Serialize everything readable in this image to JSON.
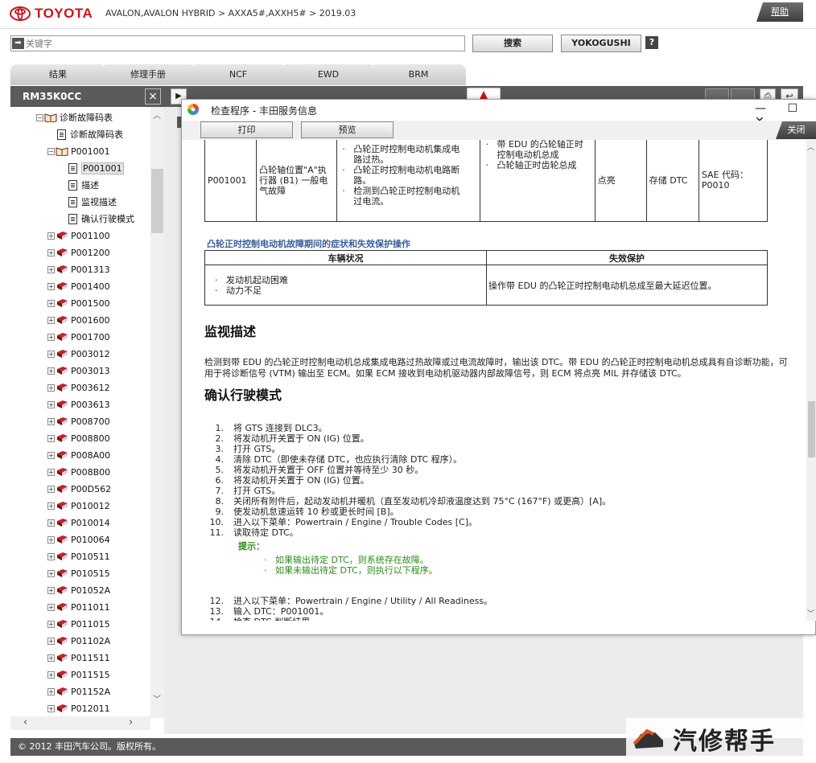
{
  "header": {
    "brand": "TOYOTA",
    "breadcrumb": "AVALON,AVALON HYBRID > AXXA5#,AXXH5# > 2019.03",
    "help_label": "帮助"
  },
  "search": {
    "placeholder": "关键字",
    "search_button": "搜索",
    "yokogushi_button": "YOKOGUSHI",
    "help_icon": "?"
  },
  "tabs": [
    "结果",
    "修理手册",
    "NCF",
    "EWD",
    "BRM"
  ],
  "left_panel": {
    "title": "RM35K0CC",
    "close": "×",
    "tree": [
      {
        "label": "诊断故障码表",
        "kind": "book-open",
        "indent": 1,
        "expander": "−"
      },
      {
        "label": "诊断故障码表",
        "kind": "page",
        "indent": 2
      },
      {
        "label": "P001001",
        "kind": "book-open",
        "indent": 2,
        "expander": "−"
      },
      {
        "label": "P001001",
        "kind": "page",
        "indent": 3,
        "selected": true
      },
      {
        "label": "描述",
        "kind": "page",
        "indent": 3
      },
      {
        "label": "监视描述",
        "kind": "page",
        "indent": 3
      },
      {
        "label": "确认行驶模式",
        "kind": "page",
        "indent": 3
      },
      {
        "label": "P001100",
        "kind": "book",
        "indent": 2,
        "expander": "+"
      },
      {
        "label": "P001200",
        "kind": "book",
        "indent": 2,
        "expander": "+"
      },
      {
        "label": "P001313",
        "kind": "book",
        "indent": 2,
        "expander": "+"
      },
      {
        "label": "P001400",
        "kind": "book",
        "indent": 2,
        "expander": "+"
      },
      {
        "label": "P001500",
        "kind": "book",
        "indent": 2,
        "expander": "+"
      },
      {
        "label": "P001600",
        "kind": "book",
        "indent": 2,
        "expander": "+"
      },
      {
        "label": "P001700",
        "kind": "book",
        "indent": 2,
        "expander": "+"
      },
      {
        "label": "P003012",
        "kind": "book",
        "indent": 2,
        "expander": "+"
      },
      {
        "label": "P003013",
        "kind": "book",
        "indent": 2,
        "expander": "+"
      },
      {
        "label": "P003612",
        "kind": "book",
        "indent": 2,
        "expander": "+"
      },
      {
        "label": "P003613",
        "kind": "book",
        "indent": 2,
        "expander": "+"
      },
      {
        "label": "P008700",
        "kind": "book",
        "indent": 2,
        "expander": "+"
      },
      {
        "label": "P008800",
        "kind": "book",
        "indent": 2,
        "expander": "+"
      },
      {
        "label": "P008A00",
        "kind": "book",
        "indent": 2,
        "expander": "+"
      },
      {
        "label": "P008B00",
        "kind": "book",
        "indent": 2,
        "expander": "+"
      },
      {
        "label": "P00D562",
        "kind": "book",
        "indent": 2,
        "expander": "+"
      },
      {
        "label": "P010012",
        "kind": "book",
        "indent": 2,
        "expander": "+"
      },
      {
        "label": "P010014",
        "kind": "book",
        "indent": 2,
        "expander": "+"
      },
      {
        "label": "P010064",
        "kind": "book",
        "indent": 2,
        "expander": "+"
      },
      {
        "label": "P010511",
        "kind": "book",
        "indent": 2,
        "expander": "+"
      },
      {
        "label": "P010515",
        "kind": "book",
        "indent": 2,
        "expander": "+"
      },
      {
        "label": "P01052A",
        "kind": "book",
        "indent": 2,
        "expander": "+"
      },
      {
        "label": "P011011",
        "kind": "book",
        "indent": 2,
        "expander": "+"
      },
      {
        "label": "P011015",
        "kind": "book",
        "indent": 2,
        "expander": "+"
      },
      {
        "label": "P01102A",
        "kind": "book",
        "indent": 2,
        "expander": "+"
      },
      {
        "label": "P011511",
        "kind": "book",
        "indent": 2,
        "expander": "+"
      },
      {
        "label": "P011515",
        "kind": "book",
        "indent": 2,
        "expander": "+"
      },
      {
        "label": "P01152A",
        "kind": "book",
        "indent": 2,
        "expander": "+"
      },
      {
        "label": "P012011",
        "kind": "book",
        "indent": 2,
        "expander": "+"
      }
    ]
  },
  "footer": {
    "copyright": "© 2012 丰田汽车公司。版权所有。"
  },
  "watermark": {
    "text": "汽修帮手"
  },
  "popup": {
    "title": "检查程序 - 丰田服务信息",
    "print_button": "打印",
    "preview_button": "预览",
    "close_label": "关闭",
    "dtc_row": {
      "code": "P001001",
      "name": "凸轮轴位置\"A\"执行器 (B1) 一般电气故障",
      "conditions": [
        "凸轮正时控制电动机集成电路过热。",
        "凸轮正时控制电动机电路断路。",
        "检测到凸轮正时控制电动机过电流。"
      ],
      "areas": [
        "带 EDU 的凸轮轴正时控制电动机总成",
        "凸轮轴正时齿轮总成"
      ],
      "mil": "点亮",
      "memory": "存储 DTC",
      "sae": "SAE 代码：P0010"
    },
    "failsafe": {
      "title": "凸轮正时控制电动机故障期间的症状和失效保护操作",
      "col1": "车辆状况",
      "col2": "失效保护",
      "symptoms": [
        "发动机起动困难",
        "动力不足"
      ],
      "action": "操作带 EDU 的凸轮正时控制电动机总成至最大延迟位置。"
    },
    "monitor": {
      "heading": "监视描述",
      "text": "检测到带 EDU 的凸轮正时控制电动机总成集成电路过热故障或过电流故障时，输出该 DTC。带 EDU 的凸轮正时控制电动机总成具有自诊断功能，可用于将诊断信号 (VTM) 输出至 ECM。如果 ECM 接收到电动机驱动器内部故障信号，则 ECM 将点亮 MIL 并存储该 DTC。"
    },
    "confirm": {
      "heading": "确认行驶模式",
      "steps": [
        {
          "n": "1.",
          "t": "将 GTS 连接到 DLC3。"
        },
        {
          "n": "2.",
          "t": "将发动机开关置于 ON (IG) 位置。"
        },
        {
          "n": "3.",
          "t": "打开 GTS。"
        },
        {
          "n": "4.",
          "t": "清除 DTC（即使未存储 DTC，也应执行清除 DTC 程序）。"
        },
        {
          "n": "5.",
          "t": "将发动机开关置于 OFF 位置并等待至少 30 秒。"
        },
        {
          "n": "6.",
          "t": "将发动机开关置于 ON (IG) 位置。"
        },
        {
          "n": "7.",
          "t": "打开 GTS。"
        },
        {
          "n": "8.",
          "t": "关闭所有附件后，起动发动机并暖机（直至发动机冷却液温度达到 75°C (167°F) 或更高）[A]。"
        },
        {
          "n": "9.",
          "t": "使发动机怠速运转 10 秒或更长时间 [B]。"
        },
        {
          "n": "10.",
          "t": "进入以下菜单：Powertrain / Engine / Trouble Codes [C]。"
        },
        {
          "n": "11.",
          "t": "读取待定 DTC。"
        }
      ],
      "hint_label": "提示：",
      "hints": [
        "如果输出待定 DTC，则系统存在故障。",
        "如果未输出待定 DTC，则执行以下程序。"
      ],
      "steps2": [
        {
          "n": "12.",
          "t": "进入以下菜单：Powertrain / Engine / Utility / All Readiness。"
        },
        {
          "n": "13.",
          "t": "输入 DTC：P001001。"
        },
        {
          "n": "14.",
          "t": "检查 DTC 判断结果。"
        }
      ]
    }
  }
}
